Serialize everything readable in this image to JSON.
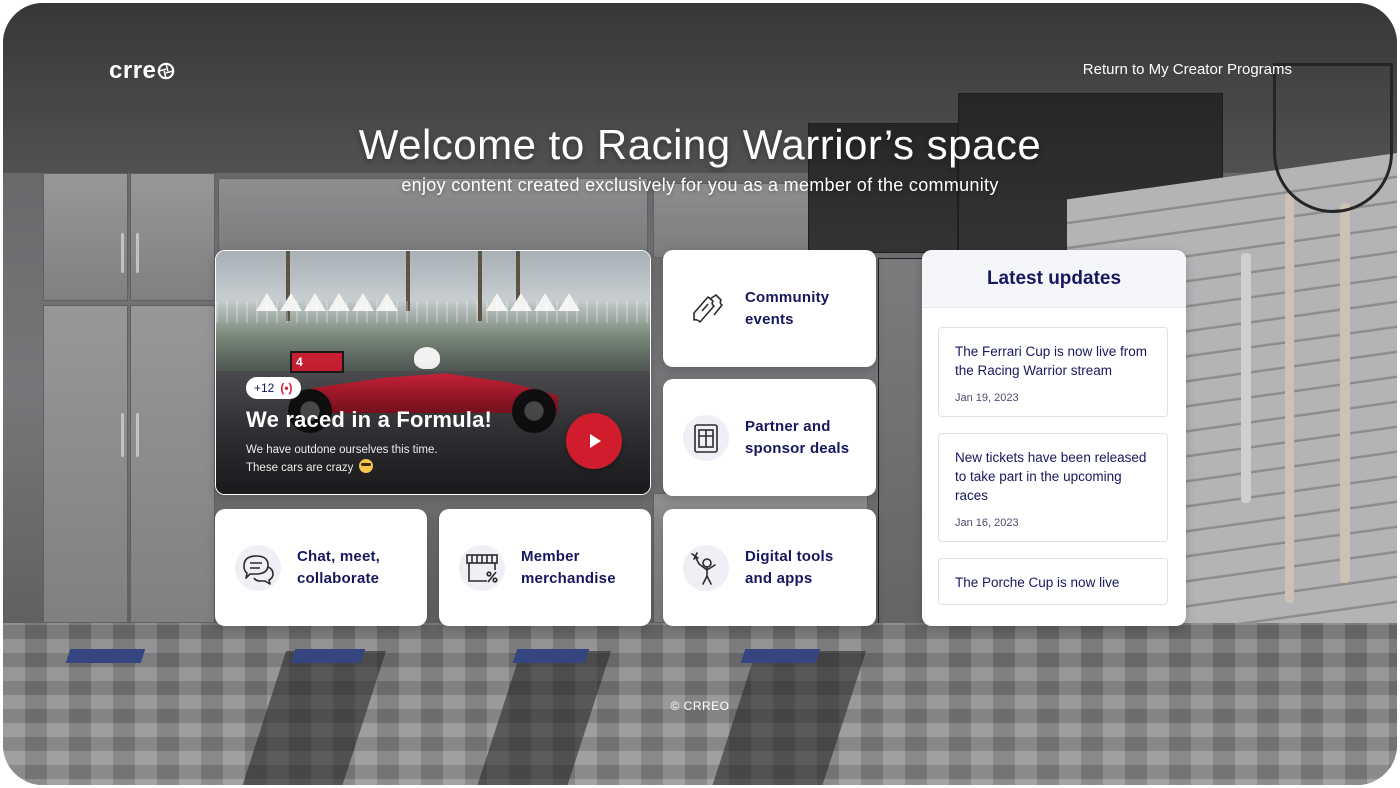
{
  "header": {
    "logo_text": "crre",
    "return_link": "Return to My Creator Programs"
  },
  "hero": {
    "title": "Welcome to Racing Warrior’s space",
    "subtitle": "enjoy content created exclusively for you as a member of the community"
  },
  "featured": {
    "badge_count": "+12",
    "title": "We raced in a Formula!",
    "description_line1": "We have outdone ourselves this time.",
    "description_line2": "These cars are crazy",
    "car_number": "4"
  },
  "cards": {
    "community_events": {
      "label_line1": "Community",
      "label_line2": "events",
      "icon": "tickets-icon"
    },
    "partner_deals": {
      "label_line1": "Partner and",
      "label_line2": "sponsor deals",
      "icon": "coupon-icon"
    },
    "chat": {
      "label_line1": "Chat, meet,",
      "label_line2": "collaborate",
      "icon": "chat-bubbles-icon"
    },
    "merch": {
      "label_line1": "Member",
      "label_line2": "merchandise",
      "icon": "store-discount-icon"
    },
    "digital_tools": {
      "label_line1": "Digital tools",
      "label_line2": "and apps",
      "icon": "person-tools-icon"
    }
  },
  "updates": {
    "title": "Latest updates",
    "items": [
      {
        "text": "The Ferrari Cup is now live from the Racing Warrior stream",
        "date": "Jan 19, 2023"
      },
      {
        "text": "New tickets have been released to take part in the upcoming races",
        "date": "Jan 16, 2023"
      },
      {
        "text": "The Porche Cup is now live",
        "date": ""
      }
    ]
  },
  "footer": {
    "copyright": "© CRREO"
  },
  "colors": {
    "navy_text": "#16185e",
    "accent_red": "#d01c2d",
    "card_bg": "#ffffff",
    "icon_circle": "#eef0f6"
  }
}
